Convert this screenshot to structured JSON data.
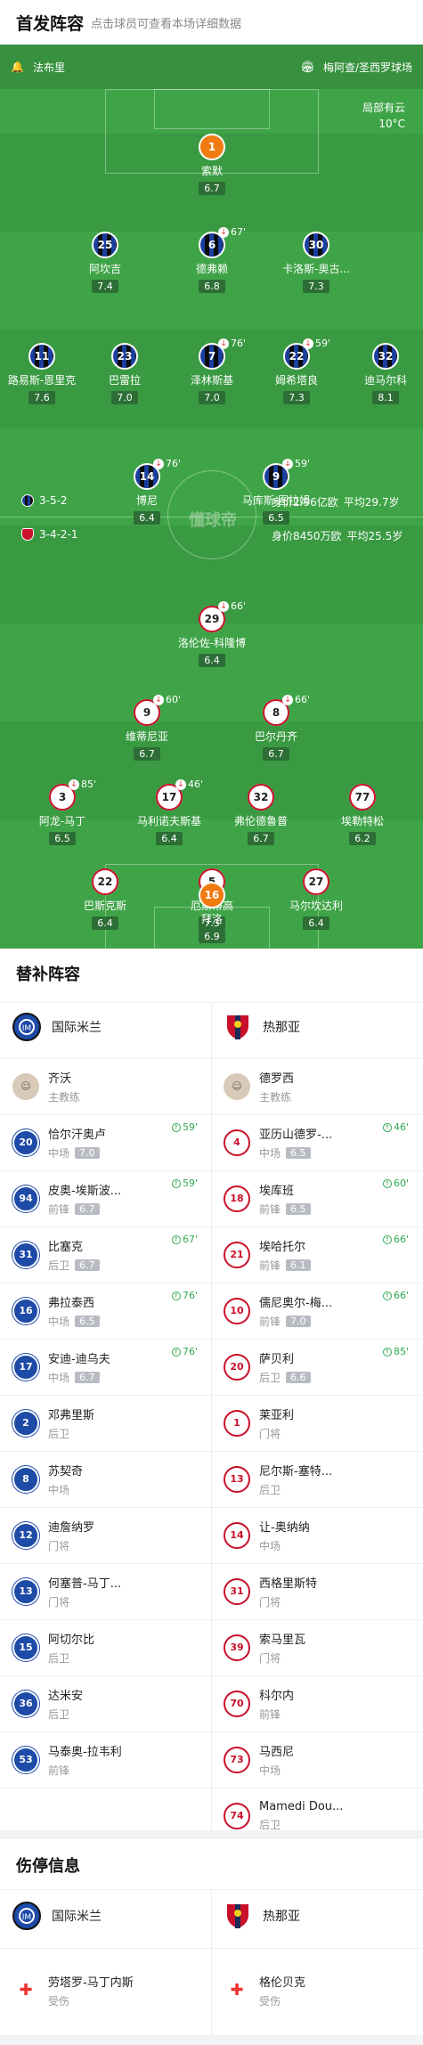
{
  "header": {
    "title": "首发阵容",
    "subtitle": "点击球员可查看本场详细数据"
  },
  "pitch": {
    "coach_label": "法布里",
    "venue": "梅阿查/圣西罗球场",
    "weather_line1": "局部有云",
    "weather_line2": "10°C",
    "watermark": "懂球帝"
  },
  "formations": {
    "inter": {
      "shape": "3-5-2",
      "value": "身价2.96亿欧",
      "age": "平均29.7岁"
    },
    "genoa": {
      "shape": "3-4-2-1",
      "value": "身价8450万欧",
      "age": "平均25.5岁"
    }
  },
  "inter_players": [
    {
      "id": "p1",
      "num": "1",
      "name": "索默",
      "rating": "6.7"
    },
    {
      "id": "p2",
      "num": "25",
      "name": "阿坎吉",
      "rating": "7.4"
    },
    {
      "id": "p3",
      "num": "6",
      "name": "德弗赖",
      "rating": "6.8",
      "sub": "67'"
    },
    {
      "id": "p4",
      "num": "30",
      "name": "卡洛斯-奥古...",
      "rating": "7.3"
    },
    {
      "id": "p5",
      "num": "11",
      "name": "路易斯-恩里克",
      "rating": "7.6"
    },
    {
      "id": "p6",
      "num": "23",
      "name": "巴雷拉",
      "rating": "7.0"
    },
    {
      "id": "p7",
      "num": "7",
      "name": "泽林斯基",
      "rating": "7.0",
      "sub": "76'"
    },
    {
      "id": "p8",
      "num": "22",
      "name": "姆希塔良",
      "rating": "7.3",
      "sub": "59'"
    },
    {
      "id": "p9",
      "num": "32",
      "name": "迪马尔科",
      "rating": "8.1"
    },
    {
      "id": "p10",
      "num": "14",
      "name": "博尼",
      "rating": "6.4",
      "sub": "76'"
    },
    {
      "id": "p11",
      "num": "9",
      "name": "马库斯-图拉姆",
      "rating": "6.5",
      "sub": "59'"
    }
  ],
  "genoa_players": [
    {
      "id": "g1",
      "num": "29",
      "name": "洛伦佐-科隆博",
      "rating": "6.4",
      "sub": "66'"
    },
    {
      "id": "g2",
      "num": "9",
      "name": "维蒂尼亚",
      "rating": "6.7",
      "sub": "60'"
    },
    {
      "id": "g3",
      "num": "8",
      "name": "巴尔丹齐",
      "rating": "6.7",
      "sub": "66'"
    },
    {
      "id": "g4",
      "num": "3",
      "name": "阿龙-马丁",
      "rating": "6.5",
      "sub": "85'"
    },
    {
      "id": "g5",
      "num": "17",
      "name": "马利诺夫斯基",
      "rating": "6.4",
      "sub": "46'"
    },
    {
      "id": "g6",
      "num": "32",
      "name": "弗伦德鲁普",
      "rating": "6.7"
    },
    {
      "id": "g7",
      "num": "77",
      "name": "埃勒特松",
      "rating": "6.2"
    },
    {
      "id": "g8",
      "num": "22",
      "name": "巴斯克斯",
      "rating": "6.4"
    },
    {
      "id": "g9",
      "num": "5",
      "name": "厄斯蒂高",
      "rating": "7.3"
    },
    {
      "id": "g10",
      "num": "27",
      "name": "马尔坎达利",
      "rating": "6.4"
    },
    {
      "id": "g11",
      "num": "16",
      "name": "拜洛",
      "rating": "6.9"
    }
  ],
  "subs": {
    "title": "替补阵容",
    "inter_name": "国际米兰",
    "genoa_name": "热那亚",
    "inter": [
      {
        "num": "",
        "name": "齐沃",
        "pos": "主教练"
      },
      {
        "num": "20",
        "name": "恰尔汗奥卢",
        "pos": "中场",
        "rating": "7.0",
        "ev": "59'"
      },
      {
        "num": "94",
        "name": "皮奥-埃斯波...",
        "pos": "前锋",
        "rating": "6.7",
        "ev": "59'"
      },
      {
        "num": "31",
        "name": "比塞克",
        "pos": "后卫",
        "rating": "6.7",
        "ev": "67'"
      },
      {
        "num": "16",
        "name": "弗拉泰西",
        "pos": "中场",
        "rating": "6.5",
        "ev": "76'"
      },
      {
        "num": "17",
        "name": "安迪-迪乌夫",
        "pos": "中场",
        "rating": "6.7",
        "ev": "76'"
      },
      {
        "num": "2",
        "name": "邓弗里斯",
        "pos": "后卫"
      },
      {
        "num": "8",
        "name": "苏契奇",
        "pos": "中场"
      },
      {
        "num": "12",
        "name": "迪詹纳罗",
        "pos": "门将"
      },
      {
        "num": "13",
        "name": "何塞普-马丁...",
        "pos": "门将"
      },
      {
        "num": "15",
        "name": "阿切尔比",
        "pos": "后卫"
      },
      {
        "num": "36",
        "name": "达米安",
        "pos": "后卫"
      },
      {
        "num": "53",
        "name": "马泰奥-拉韦利",
        "pos": "前锋"
      }
    ],
    "genoa": [
      {
        "num": "",
        "name": "德罗西",
        "pos": "主教练"
      },
      {
        "num": "4",
        "name": "亚历山德罗-...",
        "pos": "中场",
        "rating": "6.5",
        "ev": "46'"
      },
      {
        "num": "18",
        "name": "埃库班",
        "pos": "前锋",
        "rating": "6.5",
        "ev": "60'"
      },
      {
        "num": "21",
        "name": "埃哈托尔",
        "pos": "前锋",
        "rating": "6.1",
        "ev": "66'"
      },
      {
        "num": "10",
        "name": "儒尼奥尔-梅...",
        "pos": "前锋",
        "rating": "7.0",
        "ev": "66'"
      },
      {
        "num": "20",
        "name": "萨贝利",
        "pos": "后卫",
        "rating": "6.6",
        "ev": "85'"
      },
      {
        "num": "1",
        "name": "莱亚利",
        "pos": "门将"
      },
      {
        "num": "13",
        "name": "尼尔斯-塞特...",
        "pos": "后卫"
      },
      {
        "num": "14",
        "name": "让-奥纳纳",
        "pos": "中场"
      },
      {
        "num": "31",
        "name": "西格里斯特",
        "pos": "门将"
      },
      {
        "num": "39",
        "name": "索马里瓦",
        "pos": "门将"
      },
      {
        "num": "70",
        "name": "科尔内",
        "pos": "前锋"
      },
      {
        "num": "73",
        "name": "马西尼",
        "pos": "中场"
      },
      {
        "num": "74",
        "name": "Mamedi Dou...",
        "pos": "后卫"
      }
    ]
  },
  "injuries": {
    "title": "伤停信息",
    "inter_name": "国际米兰",
    "genoa_name": "热那亚",
    "inter": [
      {
        "name": "劳塔罗-马丁内斯",
        "status": "受伤"
      }
    ],
    "genoa": [
      {
        "name": "格伦贝克",
        "status": "受伤"
      }
    ]
  }
}
